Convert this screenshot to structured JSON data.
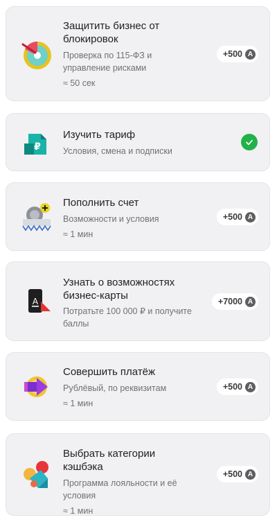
{
  "tasks": [
    {
      "title": "Защитить бизнес от блокировок",
      "subtitle": "Проверка по 115-ФЗ и управление рисками",
      "duration": "≈ 50 сек",
      "reward": "+500",
      "icon": "shield-disc-icon"
    },
    {
      "title": "Изучить тариф",
      "subtitle": "Условия, смена и подписки",
      "status": "completed",
      "icon": "ruble-document-icon"
    },
    {
      "title": "Пополнить счет",
      "subtitle": "Возможности и условия",
      "duration": "≈ 1 мин",
      "reward": "+500",
      "icon": "wallet-plus-icon"
    },
    {
      "title": "Узнать о возможностях бизнес-карты",
      "subtitle": "Потратьте 100 000 ₽ и получите баллы",
      "reward": "+7000",
      "icon": "business-card-icon"
    },
    {
      "title": "Совершить платёж",
      "subtitle": "Рублёвый, по реквизитам",
      "duration": "≈ 1 мин",
      "reward": "+500",
      "icon": "payment-arrow-icon"
    },
    {
      "title": "Выбрать категории кэшбэка",
      "subtitle": "Программа лояльности и её условия",
      "duration": "≈ 1 мин",
      "reward": "+500",
      "icon": "cashback-shapes-icon"
    }
  ],
  "coin_symbol": "A",
  "colors": {
    "card_bg": "#f1f1f3",
    "check_green": "#21b24a",
    "coin_gray": "#5f5f62"
  }
}
